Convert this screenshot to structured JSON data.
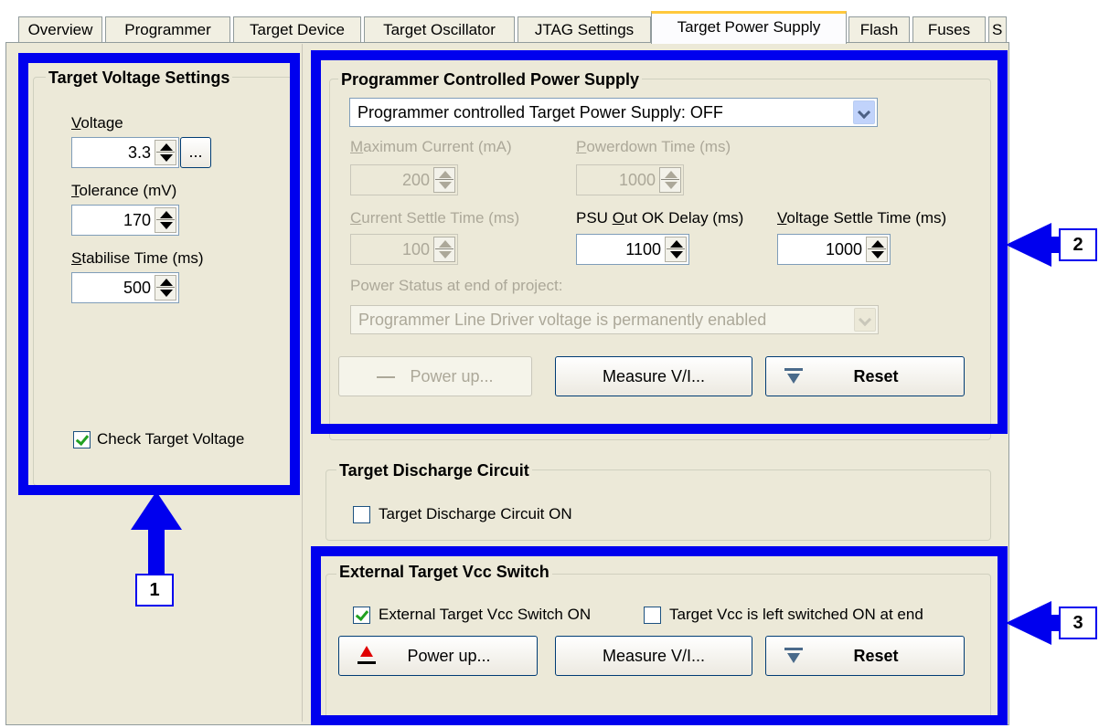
{
  "tabs": [
    {
      "label": "Overview"
    },
    {
      "label": "Programmer"
    },
    {
      "label": "Target Device"
    },
    {
      "label": "Target Oscillator"
    },
    {
      "label": "JTAG Settings"
    },
    {
      "label": "Target Power Supply"
    },
    {
      "label": "Flash"
    },
    {
      "label": "Fuses"
    },
    {
      "label": "S"
    }
  ],
  "active_tab": "Target Power Supply",
  "target_voltage": {
    "title": "Target Voltage Settings",
    "voltage_label": "Voltage",
    "voltage_value": "3.3",
    "browse_label": "...",
    "tolerance_label": "Tolerance  (mV)",
    "tolerance_value": "170",
    "stabilise_label": "Stabilise Time (ms)",
    "stabilise_value": "500",
    "check_label": "Check Target Voltage",
    "check_checked": true
  },
  "prog_power": {
    "title": "Programmer Controlled Power Supply",
    "mode_value": "Programmer controlled Target Power Supply: OFF",
    "max_current_label": "Maximum Current (mA)",
    "max_current_value": "200",
    "powerdown_label": "Powerdown Time (ms)",
    "powerdown_value": "1000",
    "current_settle_label": "Current Settle Time (ms)",
    "current_settle_value": "100",
    "psu_delay_label": "PSU Out OK Delay (ms)",
    "psu_delay_value": "1100",
    "voltage_settle_label": "Voltage Settle Time (ms)",
    "voltage_settle_value": "1000",
    "end_status_label": "Power Status at end of project:",
    "end_status_value": "Programmer Line Driver voltage is permanently enabled",
    "power_up_label": "Power up...",
    "measure_label": "Measure V/I...",
    "reset_label": "Reset"
  },
  "discharge": {
    "title": "Target Discharge Circuit",
    "check_label": "Target Discharge Circuit ON",
    "check_checked": false
  },
  "ext_vcc": {
    "title": "External Target Vcc Switch",
    "switch_label": "External Target Vcc Switch ON",
    "switch_checked": true,
    "left_on_label": "Target Vcc is left switched ON at end",
    "left_on_checked": false,
    "power_up_label": "Power up...",
    "measure_label": "Measure V/I...",
    "reset_label": "Reset"
  },
  "callouts": [
    "1",
    "2",
    "3"
  ],
  "colors": {
    "highlight": "#0000ee",
    "panel": "#ece9d8",
    "tab_active_accent": "#ffc83c"
  }
}
